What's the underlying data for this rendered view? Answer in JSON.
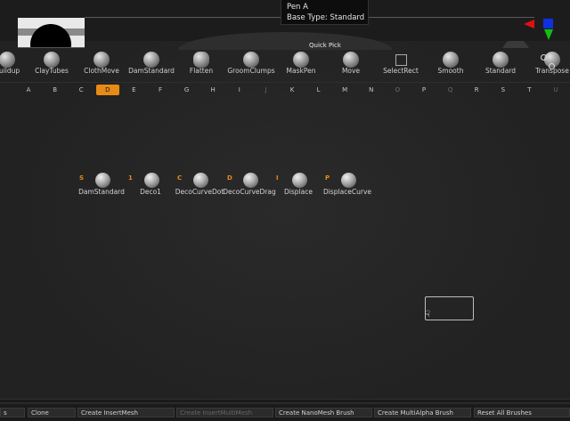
{
  "tooltip": {
    "line1": "Pen A",
    "line2": "Base Type: Standard"
  },
  "quick_pick": "Quick Pick",
  "shelf": [
    {
      "label": "Buildup",
      "icon": "buildup-brush-icon"
    },
    {
      "label": "ClayTubes",
      "icon": "claytubes-brush-icon"
    },
    {
      "label": "ClothMove",
      "icon": "clothmove-brush-icon"
    },
    {
      "label": "DamStandard",
      "icon": "damstandard-brush-icon"
    },
    {
      "label": "Flatten",
      "icon": "flatten-brush-icon"
    },
    {
      "label": "GroomClumps",
      "icon": "groomclumps-brush-icon"
    },
    {
      "label": "MaskPen",
      "icon": "maskpen-brush-icon"
    },
    {
      "label": "Move",
      "icon": "move-brush-icon"
    },
    {
      "label": "SelectRect",
      "icon": "selectrect-brush-icon"
    },
    {
      "label": "Smooth",
      "icon": "smooth-brush-icon"
    },
    {
      "label": "Standard",
      "icon": "standard-brush-icon"
    },
    {
      "label": "Transpose",
      "icon": "transpose-brush-icon"
    }
  ],
  "alphabet": [
    "A",
    "B",
    "C",
    "D",
    "E",
    "F",
    "G",
    "H",
    "I",
    "J",
    "K",
    "L",
    "M",
    "N",
    "O",
    "P",
    "Q",
    "R",
    "S",
    "T",
    "U"
  ],
  "alphabet_active": "D",
  "brushes": [
    {
      "key": "S",
      "label": "DamStandard"
    },
    {
      "key": "1",
      "label": "Deco1"
    },
    {
      "key": "C",
      "label": "DecoCurveDot"
    },
    {
      "key": "D",
      "label": "DecoCurveDrag"
    },
    {
      "key": "I",
      "label": "Displace"
    },
    {
      "key": "P",
      "label": "DisplaceCurve"
    }
  ],
  "bottom": [
    {
      "label": "s",
      "enabled": true
    },
    {
      "label": "Clone",
      "enabled": true
    },
    {
      "label": "Create InsertMesh",
      "enabled": true
    },
    {
      "label": "Create InsertMultiMesh",
      "enabled": false
    },
    {
      "label": "Create NanoMesh Brush",
      "enabled": true
    },
    {
      "label": "Create MultiAlpha Brush",
      "enabled": true
    },
    {
      "label": "Reset All Brushes",
      "enabled": true
    }
  ],
  "colors": {
    "accent": "#e88a16",
    "background": "#252525",
    "gizmo_x": "#e01010",
    "gizmo_y": "#10c010",
    "gizmo_z": "#1030e0"
  }
}
